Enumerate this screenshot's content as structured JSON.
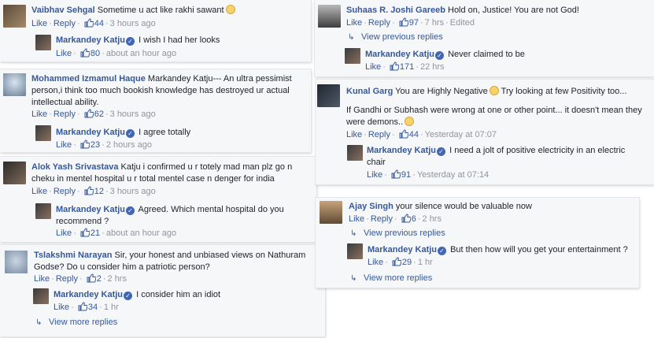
{
  "comments": [
    {
      "author": "Vaibhav Sehgal",
      "text": "Sometime u act like rakhi sawant",
      "like": "Like",
      "reply": "Reply",
      "likes": "44",
      "time": "3 hours ago",
      "reply_author": "Markandey Katju",
      "reply_text": "I wish I had her looks",
      "reply_likes": "80",
      "reply_time": "about an hour ago"
    },
    {
      "author": "Mohammed Izmamul Haque",
      "text": "Markandey Katju--- An ultra pessimist person,i think too much bookish knowledge has destroyed ur actual intellectual ability.",
      "like": "Like",
      "reply": "Reply",
      "likes": "62",
      "time": "3 hours ago",
      "reply_author": "Markandey Katju",
      "reply_text": "I agree totally",
      "reply_likes": "23",
      "reply_time": "2 hours ago"
    },
    {
      "author": "Alok Yash Srivastava",
      "text": "Katju i confirmed u r totely mad man plz go n cheku in mentel hospital u r total mentel case n denger for india",
      "like": "Like",
      "reply": "Reply",
      "likes": "12",
      "time": "3 hours ago",
      "reply_author": "Markandey Katju",
      "reply_text": "Agreed. Which mental hospital do you recommend ?",
      "reply_likes": "21",
      "reply_time": "about an hour ago"
    },
    {
      "author": "Tslakshmi Narayan",
      "text": "Sir, your honest and unbiased views on Nathuram Godse? Do u consider him a patriotic person?",
      "like": "Like",
      "reply": "Reply",
      "likes": "2",
      "time": "2 hrs",
      "reply_author": "Markandey Katju",
      "reply_text": "I consider him an idiot",
      "reply_likes": "34",
      "reply_time": "1 hr",
      "more_replies": "View more replies"
    },
    {
      "author": "Suhaas R. Joshi Gareeb",
      "text": "Hold on, Justice! You are not God!",
      "like": "Like",
      "reply": "Reply",
      "likes": "97",
      "time": "7 hrs",
      "edited": "Edited",
      "previous_replies": "View previous replies",
      "reply_author": "Markandey Katju",
      "reply_text": "Never claimed to be",
      "reply_likes": "171",
      "reply_time": "22 hrs"
    },
    {
      "author": "Kunal Garg",
      "text": "You are Highly Negative",
      "text_cont": "Try looking at few Positivity too...",
      "text2": "If Gandhi or Subhash were wrong at one or other point... it doesn't mean they were demons..",
      "like": "Like",
      "reply": "Reply",
      "likes": "44",
      "time": "Yesterday at 07:07",
      "reply_author": "Markandey Katju",
      "reply_text": "I need a jolt of positive electricity in an electric chair",
      "reply_likes": "91",
      "reply_time": "Yesterday at 07:14"
    },
    {
      "author": "Ajay Singh",
      "text": "your silence would be valuable now",
      "like": "Like",
      "reply": "Reply",
      "likes": "6",
      "time": "2 hrs",
      "previous_replies": "View previous replies",
      "reply_author": "Markandey Katju",
      "reply_text": "But then how will you get your entertainment ?",
      "reply_likes": "29",
      "reply_time": "1 hr",
      "more_replies": "View more replies"
    }
  ],
  "colors": {
    "link": "#365899",
    "meta": "#90949c",
    "card_bg": "#f6f7f9",
    "verified": "#4267b2"
  },
  "icons": {
    "like": "thumbs-up-icon",
    "verified": "verified-badge-icon",
    "reply_arrow": "reply-arrow-icon",
    "emoji": "smiley-emoji-icon"
  }
}
